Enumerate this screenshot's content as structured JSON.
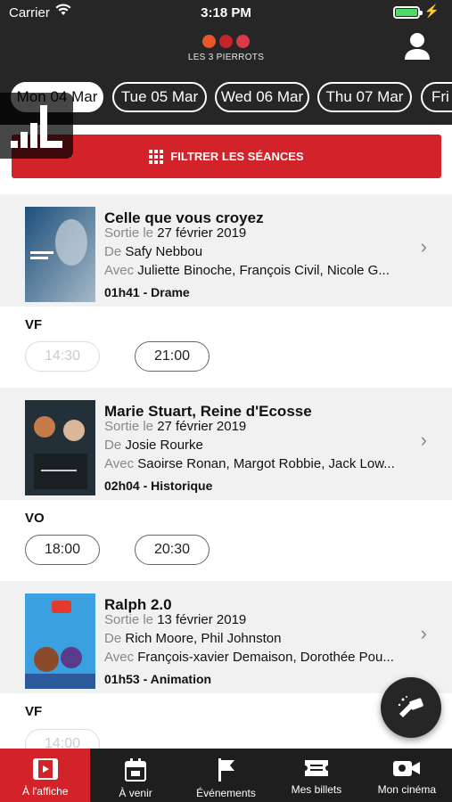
{
  "status": {
    "carrier": "Carrier",
    "time": "3:18 PM",
    "battery_level": 1.0
  },
  "brand": {
    "name": "LES 3 PIERROTS",
    "colors": [
      "#e8542b",
      "#c8232b",
      "#d83a4a"
    ]
  },
  "dates": [
    {
      "label": "Mon 04 Mar",
      "active": true
    },
    {
      "label": "Tue 05 Mar",
      "active": false
    },
    {
      "label": "Wed 06 Mar",
      "active": false
    },
    {
      "label": "Thu 07 Mar",
      "active": false
    },
    {
      "label": "Fri",
      "active": false
    }
  ],
  "filter": {
    "label": "FILTRER LES SÉANCES"
  },
  "films": [
    {
      "title": "Celle que vous croyez",
      "release_prefix": "Sortie le",
      "release": "27 février 2019",
      "director_prefix": "De",
      "director": "Safy Nebbou",
      "cast_prefix": "Avec",
      "cast": "Juliette Binoche,  François Civil,  Nicole G...",
      "meta": "01h41 - Drame",
      "version": "VF",
      "showtimes": [
        {
          "time": "14:30",
          "available": false
        },
        {
          "time": "21:00",
          "available": true
        }
      ]
    },
    {
      "title": "Marie Stuart, Reine d'Ecosse",
      "release_prefix": "Sortie le",
      "release": "27 février 2019",
      "director_prefix": "De",
      "director": "Josie Rourke",
      "cast_prefix": "Avec",
      "cast": "Saoirse Ronan,  Margot Robbie,  Jack Low...",
      "meta": "02h04 - Historique",
      "version": "VO",
      "showtimes": [
        {
          "time": "18:00",
          "available": true
        },
        {
          "time": "20:30",
          "available": true
        }
      ]
    },
    {
      "title": "Ralph 2.0",
      "release_prefix": "Sortie le",
      "release": "13 février 2019",
      "director_prefix": "De",
      "director": "Rich Moore,  Phil Johnston",
      "cast_prefix": "Avec",
      "cast": "François-xavier Demaison,  Dorothée Pou...",
      "meta": "01h53 - Animation",
      "version": "VF",
      "showtimes": [
        {
          "time": "14:00",
          "available": false
        }
      ]
    }
  ],
  "tabs": [
    {
      "label": "À l'affiche",
      "icon": "film-icon",
      "active": true
    },
    {
      "label": "À venir",
      "icon": "calendar-icon",
      "active": false
    },
    {
      "label": "Événements",
      "icon": "flag-icon",
      "active": false
    },
    {
      "label": "Mes billets",
      "icon": "ticket-icon",
      "active": false
    },
    {
      "label": "Mon cinéma",
      "icon": "camera-icon",
      "active": false
    }
  ],
  "accent": "#d2232a"
}
